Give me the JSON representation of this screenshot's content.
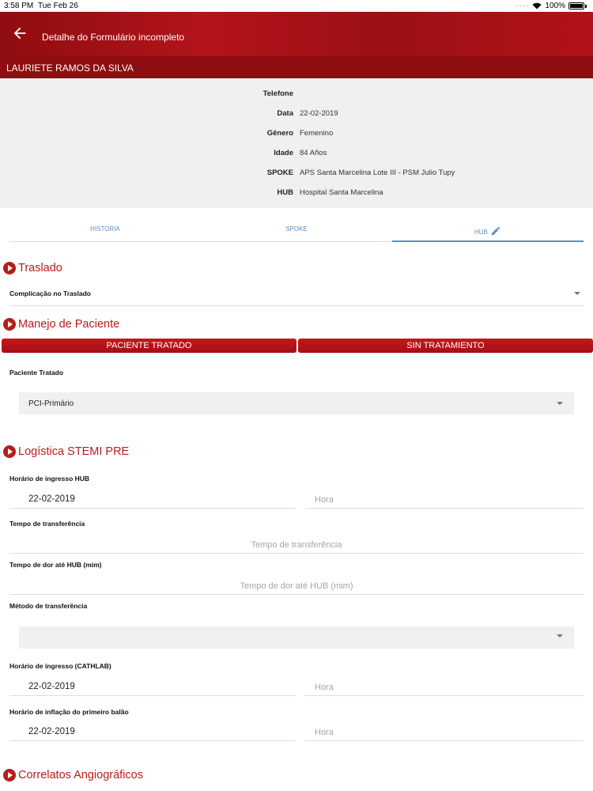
{
  "status_bar": {
    "time": "3:58 PM",
    "date": "Tue Feb 26",
    "battery": "100%"
  },
  "app_bar": {
    "title": "Detalhe do Formulário incompleto",
    "back_icon": "arrow-left-icon"
  },
  "patient": {
    "name": "LAURIETE RAMOS DA SILVA"
  },
  "info": {
    "telefone_label": "Telefone",
    "telefone_value": "",
    "data_label": "Data",
    "data_value": "22-02-2019",
    "genero_label": "Gênero",
    "genero_value": "Femenino",
    "idade_label": "Idade",
    "idade_value": "84 Años",
    "spoke_label": "SPOKE",
    "spoke_value": "APS Santa Marcelina Lote III - PSM Julio Tupy",
    "hub_label": "HUB",
    "hub_value": "Hospital Santa Marcelina"
  },
  "tabs": [
    {
      "label": "HISTORIA"
    },
    {
      "label": "SPOKE"
    },
    {
      "label": "HUB",
      "icon": "pencil-icon",
      "active": true
    }
  ],
  "sections": {
    "traslado": {
      "title": "Traslado",
      "complicacao_label": "Complicação no Traslado",
      "complicacao_value": ""
    },
    "manejo": {
      "title": "Manejo de Paciente",
      "btn_tratado": "PACIENTE TRATADO",
      "btn_sin": "SIN TRATAMIENTO",
      "paciente_tratado_label": "Paciente Tratado",
      "paciente_tratado_value": "PCI-Primário"
    },
    "logistica": {
      "title": "Logística STEMI PRE",
      "ingresso_hub_label": "Horário de ingresso HUB",
      "ingresso_hub_date": "22-02-2019",
      "ingresso_hub_hora_placeholder": "Hora",
      "tempo_transferencia_label": "Tempo de transferência",
      "tempo_transferencia_placeholder": "Tempo de transferência",
      "tempo_dor_label": "Tempo de dor até HUB (mim)",
      "tempo_dor_placeholder": "Tempo de dor até HUB (mim)",
      "metodo_label": "Método de transferência",
      "metodo_value": "",
      "cathlab_label": "Horário de ingresso (CATHLAB)",
      "cathlab_date": "22-02-2019",
      "cathlab_hora_placeholder": "Hora",
      "balao_label": "Horário de inflação do primeiro balão",
      "balao_date": "22-02-2019",
      "balao_hora_placeholder": "Hora"
    },
    "correlatos": {
      "title": "Correlatos Angiográficos"
    }
  },
  "colors": {
    "brand_red": "#b71c1c",
    "tab_blue": "#5d8fc5"
  }
}
